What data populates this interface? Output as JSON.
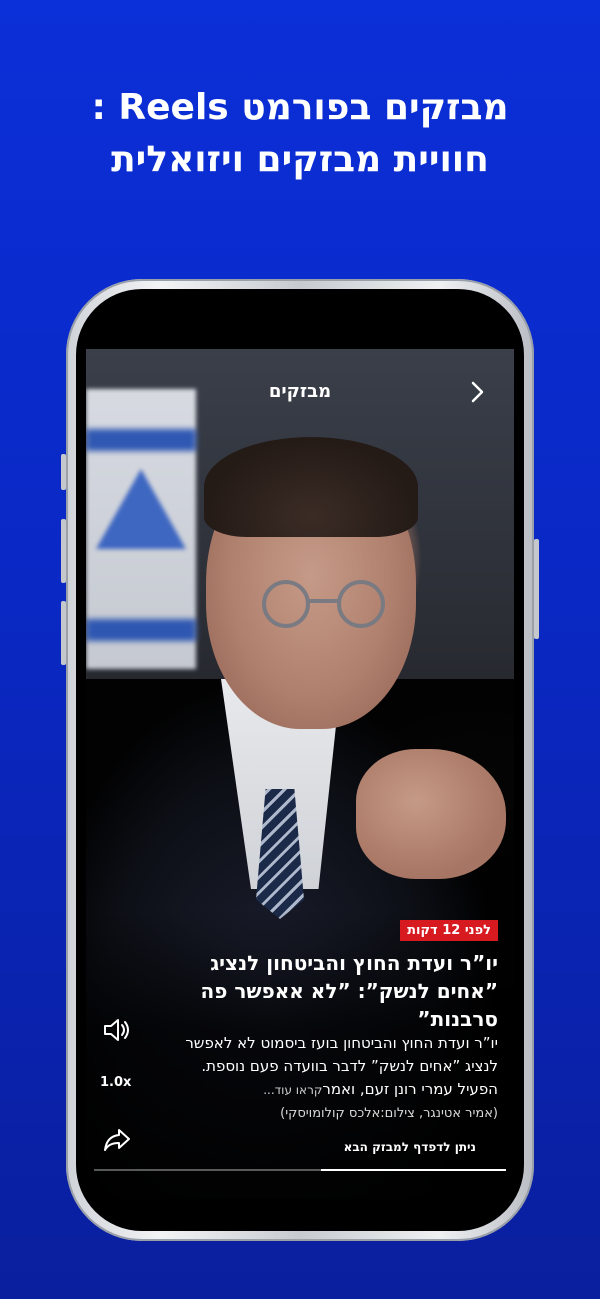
{
  "promo": {
    "title_line1": "מבזקים בפורמט Reels :",
    "title_line2": "חוויית מבזקים ויזואלית"
  },
  "header": {
    "title": "מבזקים",
    "back_icon": "chevron-right-icon"
  },
  "article": {
    "time_badge": "לפני 12 דקות",
    "headline": "יו”ר ועדת החוץ והביטחון לנציג ”אחים לנשק”: ”לא אאפשר פה סרבנות”",
    "summary": "יו”ר ועדת החוץ והביטחון בועז ביסמוט לא לאפשר לנציג ”אחים לנשק” לדבר בוועדה פעם נוספת. הפעיל עמרי רונן זעם, ואמר",
    "read_more": "קראו עוד...",
    "credit": "(אמיר אטינגר, צילום:אלכס קולומויסקי)"
  },
  "controls": {
    "sound_icon": "speaker-icon",
    "speed_label": "1.0x",
    "share_icon": "share-icon"
  },
  "footer": {
    "swipe_hint": "ניתן לדפדף למבזק הבא"
  },
  "progress": {
    "fraction": 0.45
  },
  "colors": {
    "background_top": "#0b2fd8",
    "badge_red": "#d71920"
  }
}
